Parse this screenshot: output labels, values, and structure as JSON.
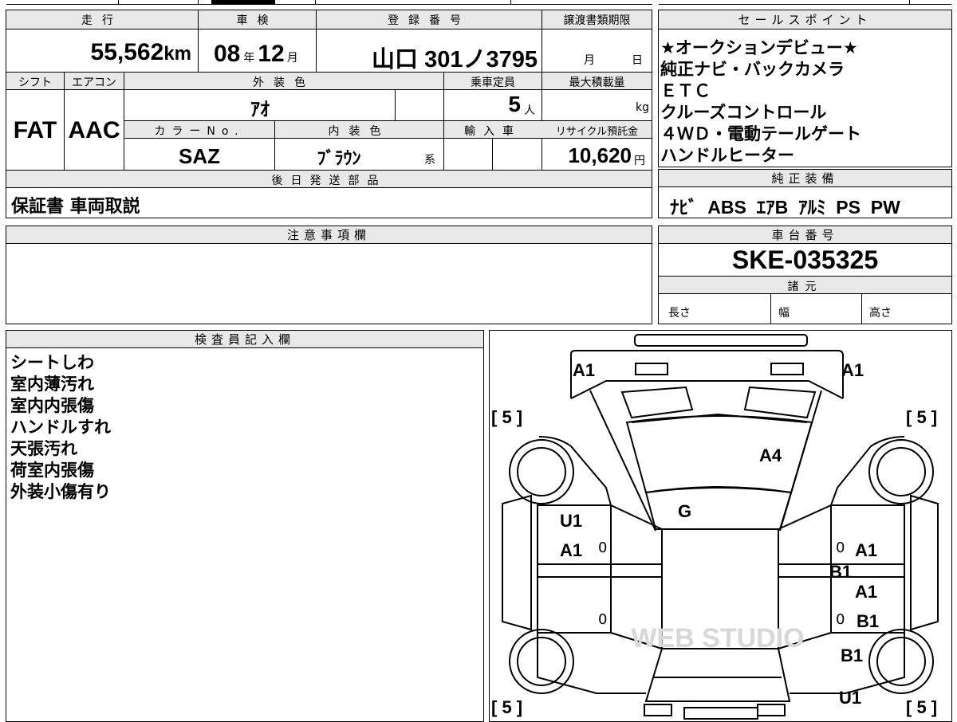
{
  "vehicle": {
    "headers": {
      "mileage": "走行",
      "inspection": "車検",
      "registration": "登録番号",
      "transfer_deadline": "譲渡書類期限",
      "shift": "シフト",
      "aircon": "エアコン",
      "exterior_color": "外装色",
      "capacity": "乗車定員",
      "max_load": "最大積載量",
      "color_no": "カラーNo.",
      "interior_color": "内装色",
      "import": "輸入車",
      "recycle_fee": "リサイクル預託金"
    },
    "mileage": "55,562",
    "mileage_unit": "km",
    "inspection_year": "08",
    "inspection_year_unit": "年",
    "inspection_month": "12",
    "inspection_month_unit": "月",
    "registration_number": "山口 301ノ3795",
    "transfer_month_unit": "月",
    "transfer_day_unit": "日",
    "shift": "FAT",
    "aircon": "AAC",
    "exterior_color": "ｱｵ",
    "capacity": "5",
    "capacity_unit": "人",
    "max_load_unit": "kg",
    "color_no": "SAZ",
    "interior_color": "ﾌﾞﾗｳﾝ",
    "interior_color_suffix": "系",
    "recycle_fee": "10,620",
    "recycle_fee_unit": "円"
  },
  "sales_points": {
    "header": "セールスポイント",
    "items": [
      "★オークションデビュー★",
      "純正ナビ・バックカメラ",
      "ＥＴＣ",
      "クルーズコントロール",
      "４ＷＤ・電動テールゲート",
      "ハンドルヒーター"
    ]
  },
  "later_parts": {
    "header": "後日発送部品",
    "value": "保証書 車両取説"
  },
  "factory_equipment": {
    "header": "純正装備",
    "value": "ﾅﾋﾞ  ABS  ｴｱB  ｱﾙﾐ  PS  PW"
  },
  "notes": {
    "header": "注意事項欄",
    "value": ""
  },
  "chassis": {
    "header": "車台番号",
    "value": "SKE-035325"
  },
  "specs": {
    "header": "諸元",
    "length_label": "長さ",
    "width_label": "幅",
    "height_label": "高さ"
  },
  "inspector": {
    "header": "検査員記入欄",
    "items": [
      "シートしわ",
      "室内薄汚れ",
      "室内内張傷",
      "ハンドルすれ",
      "天張汚れ",
      "荷室内張傷",
      "外装小傷有り"
    ]
  },
  "diagram": {
    "marks": {
      "front_left": "A1",
      "front_right": "A1",
      "tire_fl": "[ 5 ]",
      "tire_fr": "[ 5 ]",
      "tire_rl": "[ 5 ]",
      "tire_rr": "[ 5 ]",
      "windshield": "A4",
      "roof": "G",
      "left_front_door_1": "U1",
      "left_front_door_2": "A1",
      "right_front_door_1": "A1",
      "right_front_door_2": "B1",
      "right_rear_door_1": "A1",
      "right_rear_door_2": "B1",
      "right_rear_fender": "B1",
      "right_rear_quarter": "U1",
      "zero": "0"
    },
    "watermark": "WEB STUDIO"
  }
}
